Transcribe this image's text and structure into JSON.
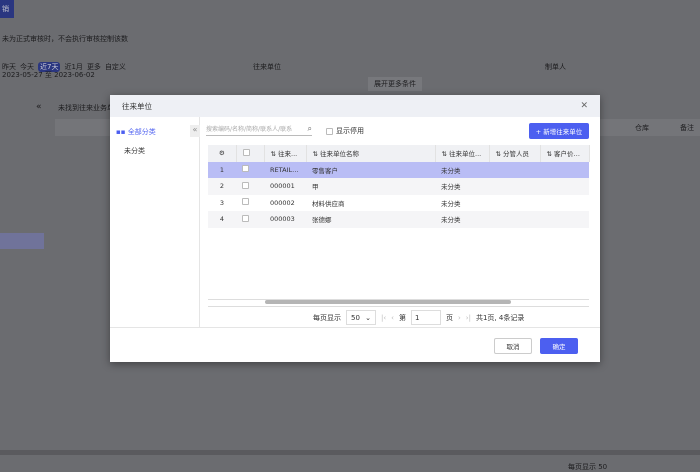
{
  "background": {
    "tab": "销",
    "notice": "未为正式审核时，不会执行审核控制该数",
    "date_quick": [
      "昨天",
      "今天",
      "近7天",
      "近1月",
      "更多",
      "自定义"
    ],
    "date_range": "2023-05-27 至 2023-06-02",
    "partner_label": "往来单位",
    "maker_label": "制单人",
    "expand": "展开更多条件",
    "list_hint": "未找到往来业务单据",
    "col_warehouse": "仓库",
    "col_note": "备注",
    "pager": "每页显示 50"
  },
  "modal": {
    "title": "往来单位",
    "tree": {
      "all": "全部分类",
      "items": [
        "未分类"
      ]
    },
    "search_placeholder": "搜索编码/名称/简称/联系人/联系",
    "show_disabled": "显示停用",
    "add_button": "+ 新增往来单位",
    "columns": [
      "往来...",
      "往来单位名称",
      "往来单位...",
      "分管人员",
      "客户价格..."
    ],
    "rows": [
      {
        "no": "1",
        "code": "RETAIL_...",
        "name": "零售客户",
        "category": "未分类",
        "staff": "",
        "price": ""
      },
      {
        "no": "2",
        "code": "000001",
        "name": "甲",
        "category": "未分类",
        "staff": "",
        "price": ""
      },
      {
        "no": "3",
        "code": "000002",
        "name": "材料供应商",
        "category": "未分类",
        "staff": "",
        "price": ""
      },
      {
        "no": "4",
        "code": "000003",
        "name": "张德娜",
        "category": "未分类",
        "staff": "",
        "price": ""
      }
    ],
    "selected_row": 1,
    "pager": {
      "per_page_label": "每页显示",
      "per_page": "50",
      "page_prefix": "第",
      "page": "1",
      "page_suffix": "页",
      "summary": "共1页, 4条记录"
    },
    "cancel": "取消",
    "ok": "确定"
  },
  "colors": {
    "accent": "#4c5ff0",
    "selected_row": "#b9bdf5"
  }
}
